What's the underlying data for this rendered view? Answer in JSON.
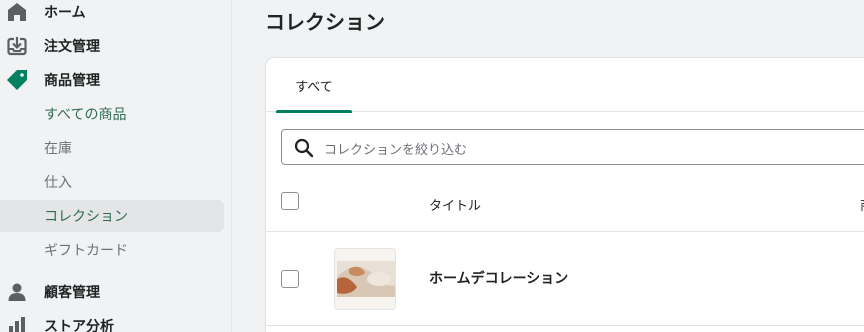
{
  "sidebar": {
    "items": [
      {
        "label": "ホーム",
        "icon": "home-icon"
      },
      {
        "label": "注文管理",
        "icon": "inbox-download-icon"
      },
      {
        "label": "商品管理",
        "icon": "tag-icon"
      },
      {
        "label": "顧客管理",
        "icon": "person-icon"
      },
      {
        "label": "ストア分析",
        "icon": "analytics-icon"
      }
    ],
    "sub_items": [
      {
        "label": "すべての商品"
      },
      {
        "label": "在庫"
      },
      {
        "label": "仕入"
      },
      {
        "label": "コレクション"
      },
      {
        "label": "ギフトカード"
      }
    ],
    "active_color": "#008060"
  },
  "main": {
    "title": "コレクション",
    "tabs": [
      {
        "label": "すべて"
      }
    ],
    "search": {
      "placeholder": "コレクションを絞り込む"
    },
    "table": {
      "columns": [
        "タイトル",
        "商"
      ],
      "rows": [
        {
          "title": "ホームデコレーション",
          "thumbnail": "collection-thumbnail-image"
        }
      ]
    }
  }
}
